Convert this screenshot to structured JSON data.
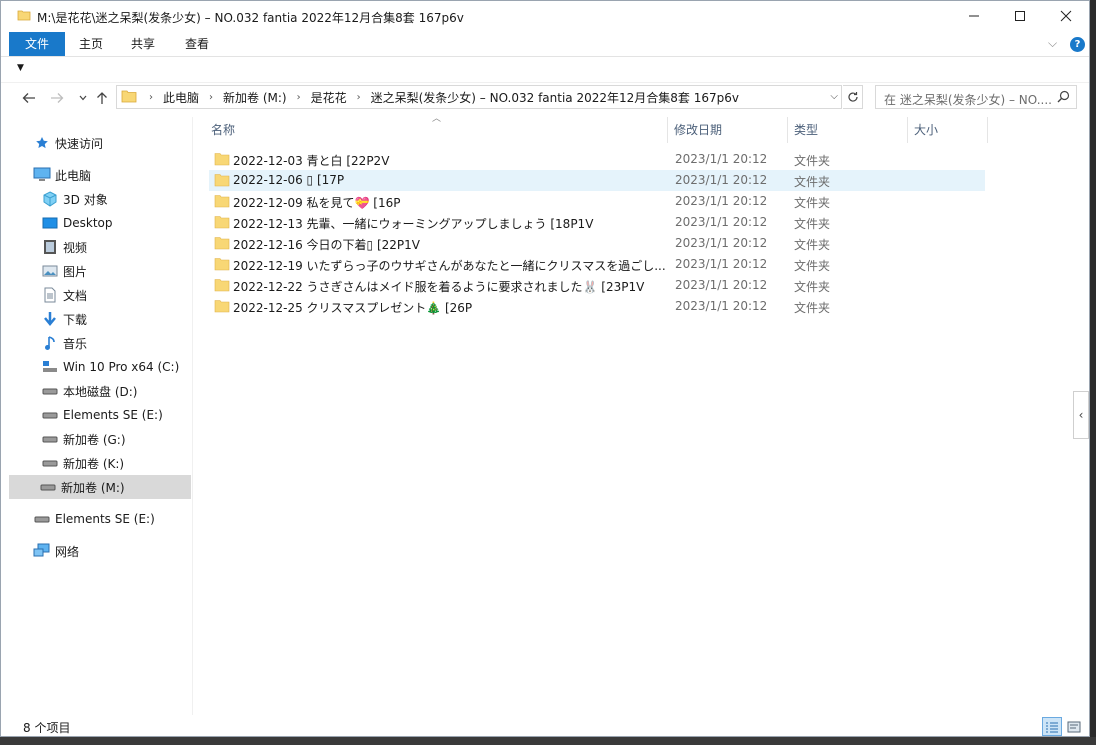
{
  "window": {
    "title": "M:\\是花花\\迷之呆梨(发条少女) – NO.032 fantia 2022年12月合集8套 167p6v"
  },
  "ribbon": {
    "tabs": [
      "文件",
      "主页",
      "共享",
      "查看"
    ]
  },
  "address": {
    "crumbs": [
      "此电脑",
      "新加卷 (M:)",
      "是花花",
      "迷之呆梨(发条少女) – NO.032 fantia 2022年12月合集8套 167p6v"
    ]
  },
  "search": {
    "placeholder": "在 迷之呆梨(发条少女) – NO...."
  },
  "navpane": {
    "items": [
      {
        "label": "快速访问",
        "icon": "star-icon"
      },
      {
        "label": "此电脑",
        "icon": "computer-icon"
      },
      {
        "label": "3D 对象",
        "icon": "cube-icon"
      },
      {
        "label": "Desktop",
        "icon": "desktop-icon"
      },
      {
        "label": "视频",
        "icon": "video-icon"
      },
      {
        "label": "图片",
        "icon": "picture-icon"
      },
      {
        "label": "文档",
        "icon": "document-icon"
      },
      {
        "label": "下载",
        "icon": "download-icon"
      },
      {
        "label": "音乐",
        "icon": "music-icon"
      },
      {
        "label": "Win 10 Pro x64 (C:)",
        "icon": "system-drive-icon"
      },
      {
        "label": "本地磁盘 (D:)",
        "icon": "drive-icon"
      },
      {
        "label": "Elements SE (E:)",
        "icon": "drive-icon"
      },
      {
        "label": "新加卷 (G:)",
        "icon": "drive-icon"
      },
      {
        "label": "新加卷 (K:)",
        "icon": "drive-icon"
      },
      {
        "label": "新加卷 (M:)",
        "icon": "drive-icon"
      },
      {
        "label": "Elements SE (E:)",
        "icon": "drive-icon"
      },
      {
        "label": "网络",
        "icon": "network-icon"
      }
    ]
  },
  "columns": {
    "name": "名称",
    "modified": "修改日期",
    "type": "类型",
    "size": "大小"
  },
  "files": [
    {
      "name": "2022-12-03 青と白 [22P2V",
      "modified": "2023/1/1 20:12",
      "type": "文件夹"
    },
    {
      "name": "2022-12-06 ▯ [17P",
      "modified": "2023/1/1 20:12",
      "type": "文件夹"
    },
    {
      "name": "2022-12-09 私を見て💝 [16P",
      "modified": "2023/1/1 20:12",
      "type": "文件夹"
    },
    {
      "name": "2022-12-13 先輩、一緒にウォーミングアップしましょう [18P1V",
      "modified": "2023/1/1 20:12",
      "type": "文件夹"
    },
    {
      "name": "2022-12-16 今日の下着▯ [22P1V",
      "modified": "2023/1/1 20:12",
      "type": "文件夹"
    },
    {
      "name": "2022-12-19 いたずらっ子のウサギさんがあなたと一緒にクリスマスを過ごし...",
      "modified": "2023/1/1 20:12",
      "type": "文件夹"
    },
    {
      "name": "2022-12-22 うさぎさんはメイド服を着るように要求されました🐰 [23P1V",
      "modified": "2023/1/1 20:12",
      "type": "文件夹"
    },
    {
      "name": "2022-12-25 クリスマスプレゼント🎄 [26P",
      "modified": "2023/1/1 20:12",
      "type": "文件夹"
    }
  ],
  "status": {
    "count": "8 个项目"
  },
  "colors": {
    "accent": "#1979ca",
    "folder": "#f8d775",
    "selected_row": "#e5f3fb"
  }
}
